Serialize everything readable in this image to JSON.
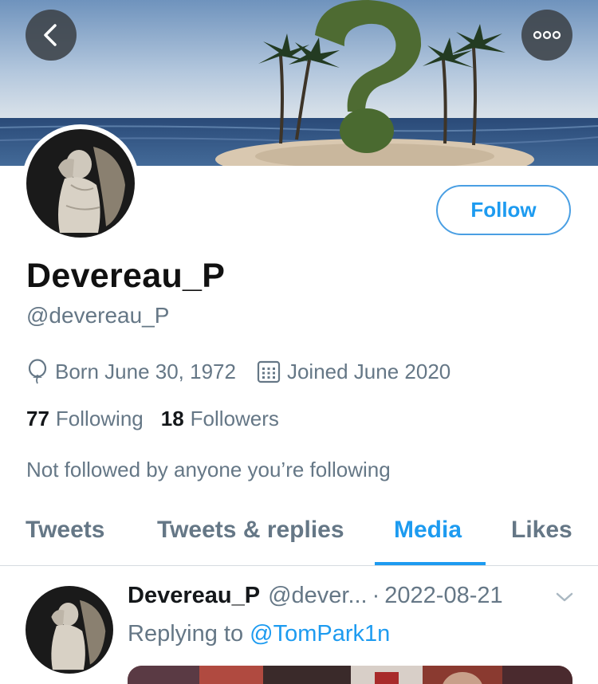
{
  "profile": {
    "display_name": "Devereau_P",
    "handle": "@devereau_P",
    "birth": "Born June 30, 1972",
    "joined": "Joined June 2020",
    "following_count": "77",
    "following_label": "Following",
    "followers_count": "18",
    "followers_label": "Followers",
    "not_followed": "Not followed by anyone you’re following"
  },
  "actions": {
    "follow_label": "Follow"
  },
  "icons": {
    "back": "chevron-left-icon",
    "more": "more-dots-icon",
    "birth": "balloon-icon",
    "joined": "calendar-icon",
    "tweet_menu": "chevron-down-icon"
  },
  "tabs": [
    {
      "label": "Tweets"
    },
    {
      "label": "Tweets & replies"
    },
    {
      "label": "Media"
    },
    {
      "label": "Likes"
    }
  ],
  "active_tab": "Media",
  "tweet": {
    "name": "Devereau_P",
    "handle": "@dever...",
    "separator": "·",
    "date": "2022-08-21",
    "replying_prefix": "Replying to",
    "replying_to": "@TomPark1n"
  },
  "colors": {
    "accent": "#1d9bf0",
    "muted": "#657786",
    "text": "#14171a"
  }
}
